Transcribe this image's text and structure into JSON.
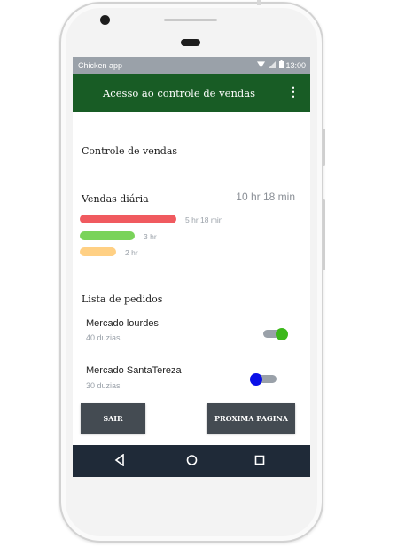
{
  "status_bar": {
    "app_name": "Chicken app",
    "time": "13:00"
  },
  "app_bar": {
    "title": "Acesso ao controle de  vendas",
    "menu_icon": "more-vert-icon"
  },
  "main": {
    "section_title": "Controle de vendas",
    "daily": {
      "title": "Vendas diária",
      "total": "10 hr 18 min",
      "bars": [
        {
          "label": "5 hr 18 min",
          "color": "#f05a5f",
          "hours": 5.3
        },
        {
          "label": "3 hr",
          "color": "#7ad35a",
          "hours": 3
        },
        {
          "label": "2 hr",
          "color": "#ffd084",
          "hours": 2
        }
      ]
    },
    "orders": {
      "title": "Lista de pedidos",
      "items": [
        {
          "name": "Mercado lourdes",
          "quantity": "40 duzias",
          "toggle_on": true,
          "knob_color": "#3cb81a"
        },
        {
          "name": "Mercado  SantaTereza",
          "quantity": "30 duzias",
          "toggle_on": false,
          "knob_color": "#0a10e8"
        }
      ]
    }
  },
  "buttons": {
    "exit": "SAIR",
    "next": "PROXIMA PAGINA"
  },
  "colors": {
    "app_bar": "#185c25",
    "status_bar": "#9aa1a9",
    "nav_bar": "#1f2a38",
    "button": "#444b52"
  }
}
